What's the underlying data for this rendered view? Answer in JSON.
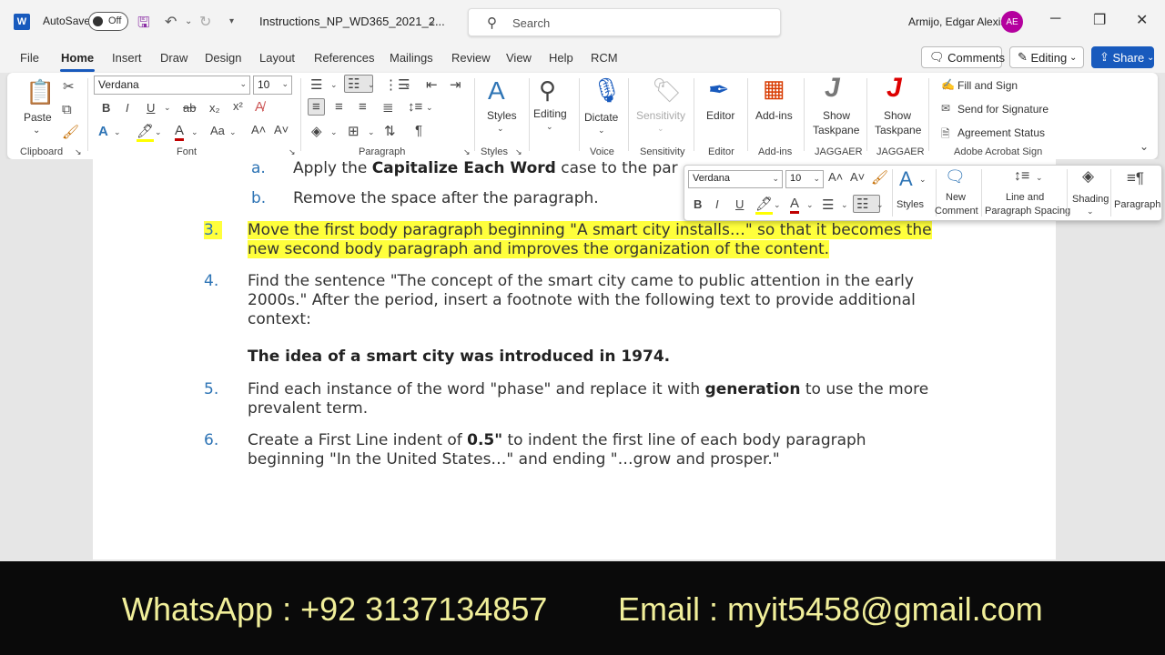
{
  "titlebar": {
    "app_logo": "W",
    "autosave_label": "AutoSave",
    "autosave_state": "Off",
    "doc_title": "Instructions_NP_WD365_2021_2...",
    "search_placeholder": "Search",
    "user_name": "Armijo, Edgar Alexis",
    "user_initials": "AE",
    "accent_color": "#185abd"
  },
  "tabs": [
    "File",
    "Home",
    "Insert",
    "Draw",
    "Design",
    "Layout",
    "References",
    "Mailings",
    "Review",
    "View",
    "Help",
    "RCM"
  ],
  "active_tab": "Home",
  "top_buttons": {
    "comments": "Comments",
    "editing": "Editing",
    "share": "Share"
  },
  "ribbon": {
    "clipboard": {
      "paste": "Paste",
      "group": "Clipboard"
    },
    "font": {
      "family": "Verdana",
      "size": "10",
      "group": "Font"
    },
    "paragraph": {
      "group": "Paragraph"
    },
    "styles": {
      "label": "Styles",
      "group": "Styles"
    },
    "editing": {
      "label": "Editing"
    },
    "voice": {
      "label": "Dictate",
      "group": "Voice"
    },
    "sensitivity": {
      "label": "Sensitivity",
      "group": "Sensitivity"
    },
    "editor": {
      "label": "Editor",
      "group": "Editor"
    },
    "addins": {
      "label": "Add-ins",
      "group": "Add-ins"
    },
    "jaggaer1": {
      "label1": "Show",
      "label2": "Taskpane",
      "group": "JAGGAER"
    },
    "jaggaer2": {
      "label1": "Show",
      "label2": "Taskpane",
      "group": "JAGGAER"
    },
    "acrobat": {
      "fill_sign": "Fill and Sign",
      "send_sign": "Send for Signature",
      "agreement": "Agreement Status",
      "group": "Adobe Acrobat Sign"
    }
  },
  "mini_toolbar": {
    "font": "Verdana",
    "size": "10",
    "styles": "Styles",
    "new_comment_1": "New",
    "new_comment_2": "Comment",
    "line_spacing_1": "Line and",
    "line_spacing_2": "Paragraph Spacing",
    "shading": "Shading",
    "paragraph": "Paragraph"
  },
  "document": {
    "item_a": {
      "num": "a.",
      "pre": "Apply the ",
      "bold": "Capitalize Each Word",
      "post": " case to the par"
    },
    "item_b": {
      "num": "b.",
      "text": "Remove the space after the paragraph."
    },
    "item_3": {
      "num": "3.",
      "line1": "Move the first body paragraph beginning \"A smart city installs…\" so that it becomes the",
      "line2": "new second body paragraph and improves the organization of the content."
    },
    "item_4": {
      "num": "4.",
      "line1": "Find the sentence \"The concept of the smart city came to public attention in the early",
      "line2": "2000s.\" After the period, insert a footnote with the following text to provide additional",
      "line3": "context:",
      "bold_line": "The idea of a smart city was introduced in 1974."
    },
    "item_5": {
      "num": "5.",
      "pre": "Find each instance of the word \"phase\" and replace it with ",
      "bold": "generation",
      "post": " to use the more",
      "line2": "prevalent term."
    },
    "item_6": {
      "num": "6.",
      "pre": "Create a First Line indent of ",
      "bold": "0.5\"",
      "post": " to indent the first line of each body paragraph",
      "line2": "beginning \"In the United States…\" and ending \"…grow and prosper.\""
    }
  },
  "footer": {
    "whatsapp": "WhatsApp :  +92 3137134857",
    "email": "Email :  myit5458@gmail.com"
  }
}
